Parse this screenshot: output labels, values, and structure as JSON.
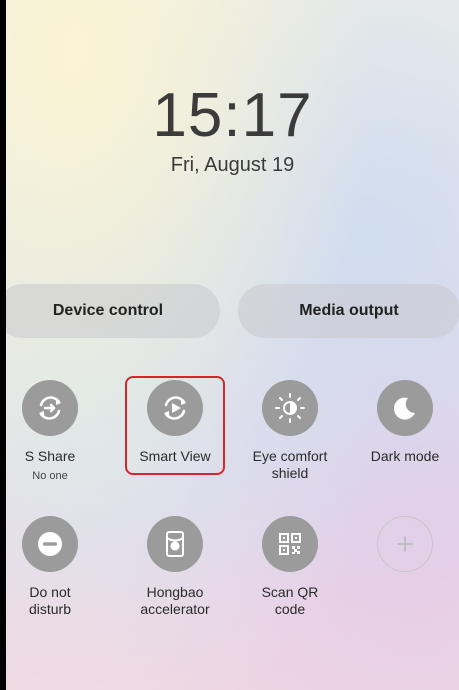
{
  "lockscreen": {
    "time": "15:17",
    "date": "Fri, August 19"
  },
  "panel_buttons": {
    "device_control": "Device control",
    "media_output": "Media output"
  },
  "tiles": [
    {
      "label": "S Share",
      "sub": "No one",
      "icon": "s-share-icon"
    },
    {
      "label": "Smart View",
      "icon": "smart-view-icon",
      "highlighted": true
    },
    {
      "label_line1": "Eye comfort",
      "label_line2": "shield",
      "icon": "eye-comfort-icon"
    },
    {
      "label": "Dark mode",
      "icon": "moon-icon"
    },
    {
      "label_line1": "Do not",
      "label_line2": "disturb",
      "icon": "minus-circle-icon"
    },
    {
      "label_line1": "Hongbao",
      "label_line2": "accelerator",
      "icon": "hongbao-icon"
    },
    {
      "label_line1": "Scan QR",
      "label_line2": "code",
      "icon": "qr-code-icon"
    },
    {
      "label": "",
      "icon": "add-icon"
    }
  ],
  "colors": {
    "tile_icon_bg": "#9b9b9b",
    "highlight_border": "#d6262c",
    "text": "#2a2a2a"
  }
}
